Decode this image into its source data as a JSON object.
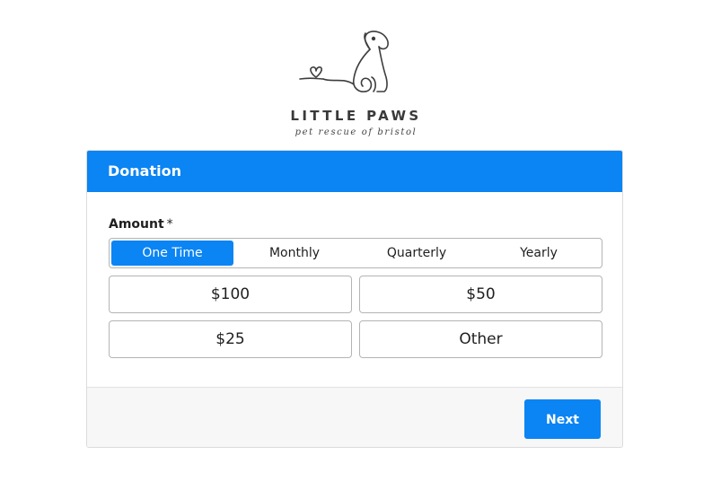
{
  "brand": {
    "logo_icon": "dog-line-art-icon",
    "name": "LITTLE PAWS",
    "tagline": "pet rescue of bristol"
  },
  "form": {
    "header": "Donation",
    "amount_label": "Amount",
    "required_mark": "*",
    "frequency_tabs": [
      {
        "label": "One Time",
        "selected": true
      },
      {
        "label": "Monthly",
        "selected": false
      },
      {
        "label": "Quarterly",
        "selected": false
      },
      {
        "label": "Yearly",
        "selected": false
      }
    ],
    "amount_options": [
      "$100",
      "$50",
      "$25",
      "Other"
    ],
    "next_label": "Next"
  },
  "colors": {
    "accent": "#0b84f4",
    "footer_bg": "#f7f7f7"
  }
}
